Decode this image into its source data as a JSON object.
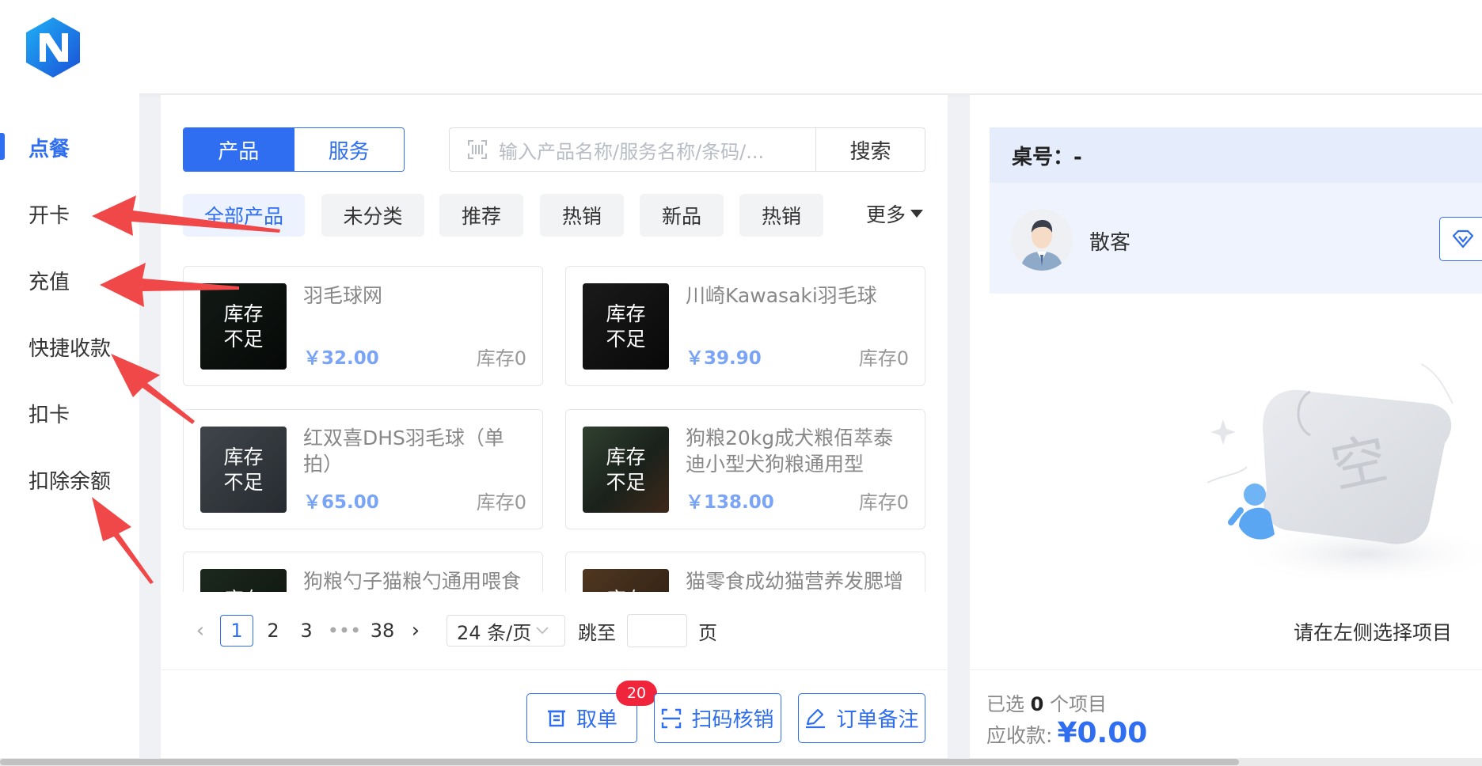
{
  "sidebar": {
    "items": [
      {
        "label": "点餐",
        "active": true
      },
      {
        "label": "开卡"
      },
      {
        "label": "充值"
      },
      {
        "label": "快捷收款"
      },
      {
        "label": "扣卡"
      },
      {
        "label": "扣除余额"
      }
    ]
  },
  "toolbar": {
    "tabs": [
      {
        "label": "产品",
        "active": true
      },
      {
        "label": "服务"
      }
    ],
    "search": {
      "placeholder": "输入产品名称/服务名称/条码/...",
      "button": "搜索"
    }
  },
  "categories": {
    "items": [
      "全部产品",
      "未分类",
      "推荐",
      "热销",
      "新品",
      "热销"
    ],
    "more": "更多"
  },
  "products": [
    {
      "name": "羽毛球网",
      "price": "￥32.00",
      "stock": "库存0",
      "status": "库存不足"
    },
    {
      "name": "川崎Kawasaki羽毛球",
      "price": "￥39.90",
      "stock": "库存0",
      "status": "库存不足"
    },
    {
      "name": "红双喜DHS羽毛球（单拍）",
      "price": "￥65.00",
      "stock": "库存0",
      "status": "库存不足"
    },
    {
      "name": "狗粮20kg成犬粮佰萃泰迪小型犬狗粮通用型",
      "price": "￥138.00",
      "stock": "库存0",
      "status": "库存不足"
    },
    {
      "name": "狗粮勺子猫粮勺通用喂食",
      "price": "",
      "stock": "",
      "status": "库存不足"
    },
    {
      "name": "猫零食成幼猫营养发腮增",
      "price": "",
      "stock": "",
      "status": "库存不足"
    }
  ],
  "pagination": {
    "pages": [
      "1",
      "2",
      "3",
      "•••",
      "38"
    ],
    "current": "1",
    "page_size": "24 条/页",
    "jump_label": "跳至",
    "page_suffix": "页"
  },
  "actions": {
    "take_order": "取单",
    "take_order_badge": "20",
    "scan_verify": "扫码核销",
    "order_note": "订单备注"
  },
  "order": {
    "table_label": "桌号：-",
    "customer": "散客",
    "empty_text": "请在左侧选择项目",
    "selected_prefix": "已选",
    "selected_count": "0",
    "selected_suffix": "个项目",
    "due_label": "应收款:",
    "due_amount": "¥0.00"
  },
  "colors": {
    "accent": "#2f6ef0",
    "badge": "#f0253b",
    "annotation_arrow": "#f04848"
  }
}
